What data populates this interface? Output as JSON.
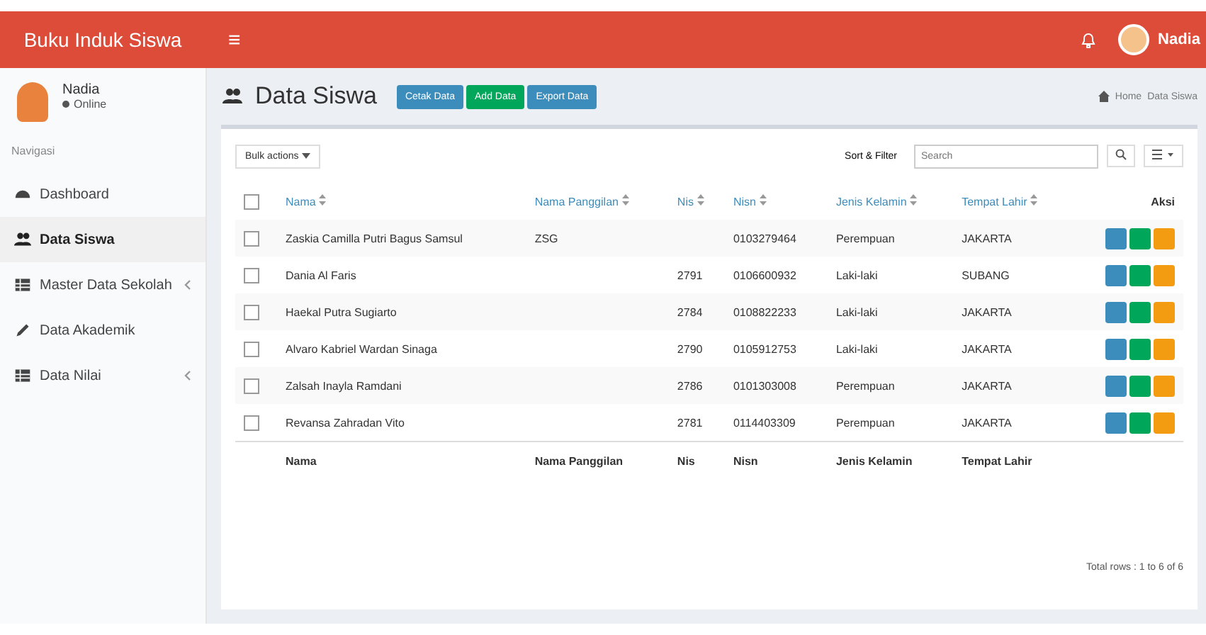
{
  "header": {
    "brand": "Buku Induk Siswa",
    "menu_toggle": "≡",
    "user_name": "Nadia"
  },
  "sidebar": {
    "user": {
      "name": "Nadia",
      "status": "Online"
    },
    "section_label": "Navigasi",
    "items": [
      {
        "label": "Dashboard",
        "kind": "dashboard",
        "selected": false,
        "has_children": false
      },
      {
        "label": "Data Siswa",
        "kind": "users",
        "selected": true,
        "has_children": false
      },
      {
        "label": "Master Data Sekolah",
        "kind": "table",
        "selected": false,
        "has_children": true
      },
      {
        "label": "Data Akademik",
        "kind": "pencil",
        "selected": false,
        "has_children": false
      },
      {
        "label": "Data Nilai",
        "kind": "table",
        "selected": false,
        "has_children": true
      }
    ]
  },
  "page": {
    "title": "Data Siswa",
    "buttons": [
      {
        "label": "Cetak Data",
        "kind": "print"
      },
      {
        "label": "Add Data",
        "kind": "add"
      },
      {
        "label": "Export Data",
        "kind": "export"
      }
    ],
    "breadcrumb": [
      "Home",
      "Data Siswa"
    ]
  },
  "toolbar": {
    "bulk_actions": "Bulk actions",
    "sort_filter": "Sort & Filter",
    "search": {
      "placeholder": "Search"
    }
  },
  "table": {
    "select_all_checked": false,
    "columns": [
      "Nama",
      "Nama Panggilan",
      "Nis",
      "Nisn",
      "Jenis Kelamin",
      "Tempat Lahir",
      "Aksi"
    ],
    "rows": [
      {
        "checked": false,
        "cells": [
          "Zaskia Camilla Putri Bagus Samsul",
          "ZSG",
          "",
          "0103279464",
          "Perempuan",
          "JAKARTA"
        ]
      },
      {
        "checked": false,
        "cells": [
          "Dania Al Faris",
          "",
          "2791",
          "0106600932",
          "Laki-laki",
          "SUBANG"
        ]
      },
      {
        "checked": false,
        "cells": [
          "Haekal Putra Sugiarto",
          "",
          "2784",
          "0108822233",
          "Laki-laki",
          "JAKARTA"
        ]
      },
      {
        "checked": false,
        "cells": [
          "Alvaro Kabriel Wardan Sinaga",
          "",
          "2790",
          "0105912753",
          "Laki-laki",
          "JAKARTA"
        ]
      },
      {
        "checked": false,
        "cells": [
          "Zalsah Inayla Ramdani",
          "",
          "2786",
          "0101303008",
          "Perempuan",
          "JAKARTA"
        ]
      },
      {
        "checked": false,
        "cells": [
          "Revansa Zahradan Vito",
          "",
          "2781",
          "0114403309",
          "Perempuan",
          "JAKARTA"
        ]
      }
    ],
    "footer": [
      "Nama",
      "Nama Panggilan",
      "Nis",
      "Nisn",
      "Jenis Kelamin",
      "Tempat Lahir"
    ],
    "summary": "Total rows : 1 to 6 of 6"
  }
}
